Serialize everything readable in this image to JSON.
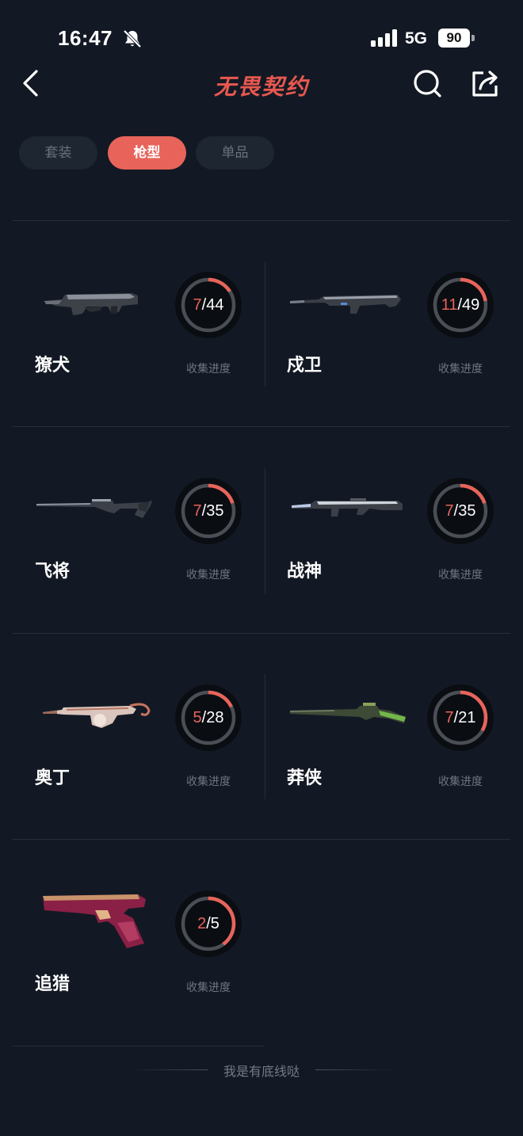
{
  "status_bar": {
    "time": "16:47",
    "network": "5G",
    "battery": "90"
  },
  "nav": {
    "title": "无畏契约",
    "back_icon": "chevron-left-icon",
    "search_icon": "search-icon",
    "share_icon": "share-icon"
  },
  "tabs": [
    {
      "label": "套装",
      "active": false
    },
    {
      "label": "枪型",
      "active": true
    },
    {
      "label": "单品",
      "active": false
    }
  ],
  "colors": {
    "accent": "#e8645a",
    "background": "#131924",
    "ring_track": "#4a4e55"
  },
  "progress_label": "收集进度",
  "weapons": [
    {
      "name": "獠犬",
      "collected": "7",
      "total": "44",
      "icon": "smg-icon"
    },
    {
      "name": "戍卫",
      "collected": "11",
      "total": "49",
      "icon": "rifle-icon"
    },
    {
      "name": "飞将",
      "collected": "7",
      "total": "35",
      "icon": "sniper-icon"
    },
    {
      "name": "战神",
      "collected": "7",
      "total": "35",
      "icon": "machine-gun-icon"
    },
    {
      "name": "奥丁",
      "collected": "5",
      "total": "28",
      "icon": "heavy-gun-icon"
    },
    {
      "name": "莽侠",
      "collected": "7",
      "total": "21",
      "icon": "marshal-rifle-icon"
    },
    {
      "name": "追猎",
      "collected": "2",
      "total": "5",
      "icon": "pistol-icon"
    }
  ],
  "footer": {
    "text": "我是有底线哒"
  }
}
